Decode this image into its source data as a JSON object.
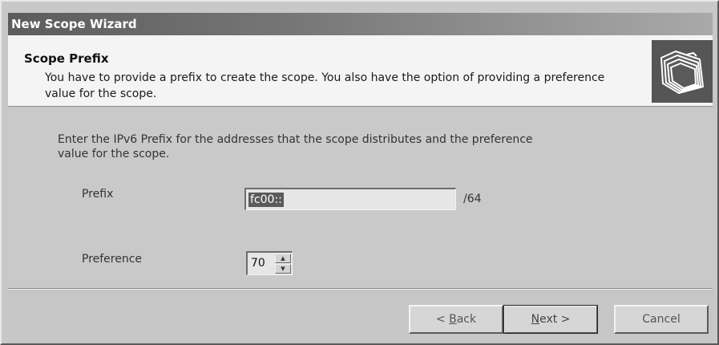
{
  "window": {
    "title": "New Scope Wizard"
  },
  "header": {
    "title": "Scope Prefix",
    "description": "You have to provide a prefix to create the scope. You also have the option of providing a preference value for the scope.",
    "icon": "folders-icon"
  },
  "main": {
    "instructions": "Enter the IPv6 Prefix for the addresses that the scope distributes and the preference value for the scope.",
    "prefix": {
      "label": "Prefix",
      "value": "fc00::",
      "suffix": "/64"
    },
    "preference": {
      "label": "Preference",
      "value": "70"
    }
  },
  "footer": {
    "back_label_pre": "< ",
    "back_label_key": "B",
    "back_label_post": "ack",
    "next_label_key": "N",
    "next_label_post": "ext >",
    "cancel_label": "Cancel"
  },
  "colors": {
    "titlebar_start": "#5c5c5c",
    "titlebar_end": "#a9a9a9",
    "header_bg": "#f4f4f4",
    "body_bg": "#c9c9c9",
    "selection": "#5a5a5a"
  }
}
